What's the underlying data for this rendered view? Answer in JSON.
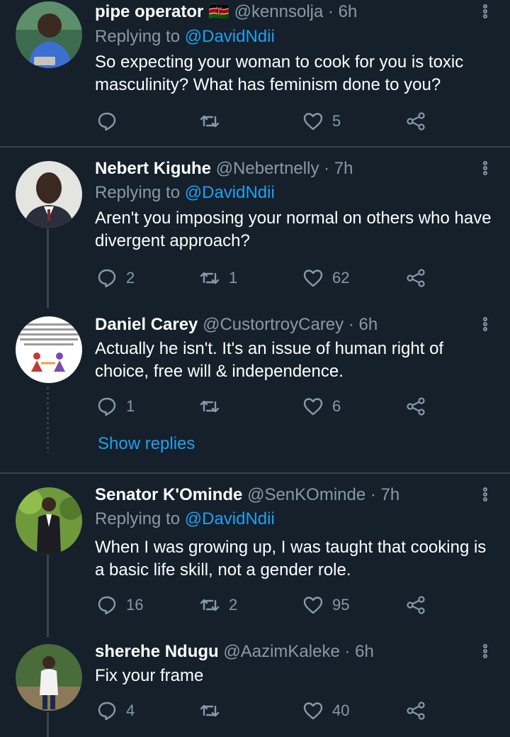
{
  "tweets": [
    {
      "name": "pipe operator 🇰🇪",
      "handle": "@kennsolja · 6h",
      "replying_label": "Replying to ",
      "replying_to": "@DavidNdii",
      "text": "So expecting your woman to cook for you is toxic masculinity? What has feminism done to you?",
      "replies": "",
      "retweets": "",
      "likes": "5"
    },
    {
      "name": "Nebert Kiguhe",
      "handle": "@Nebertnelly · 7h",
      "replying_label": "Replying to ",
      "replying_to": "@DavidNdii",
      "text": "Aren't you imposing your normal on others who have divergent approach?",
      "replies": "2",
      "retweets": "1",
      "likes": "62"
    },
    {
      "name": "Daniel Carey",
      "handle": "@CustortroyCarey · 6h",
      "text": "Actually he isn't. It's an issue of human right of choice, free will & independence.",
      "replies": "1",
      "retweets": "",
      "likes": "6",
      "show_replies": "Show replies"
    },
    {
      "name": "Senator K'Ominde",
      "handle": "@SenKOminde · 7h",
      "replying_label": "Replying to ",
      "replying_to": "@DavidNdii",
      "text": "When I was growing up, I was taught that cooking is a basic life skill, not a gender role.",
      "replies": "16",
      "retweets": "2",
      "likes": "95"
    },
    {
      "name": "sherehe Ndugu",
      "handle": "@AazimKaleke · 6h",
      "text": "Fix your frame",
      "replies": "4",
      "retweets": "",
      "likes": "40"
    }
  ],
  "colors": {
    "background": "#15202b",
    "secondary_text": "#8899a6",
    "accent": "#1da1f2",
    "divider": "#38444d"
  },
  "icons": [
    "reply-icon",
    "retweet-icon",
    "like-icon",
    "share-icon",
    "more-options-icon"
  ]
}
